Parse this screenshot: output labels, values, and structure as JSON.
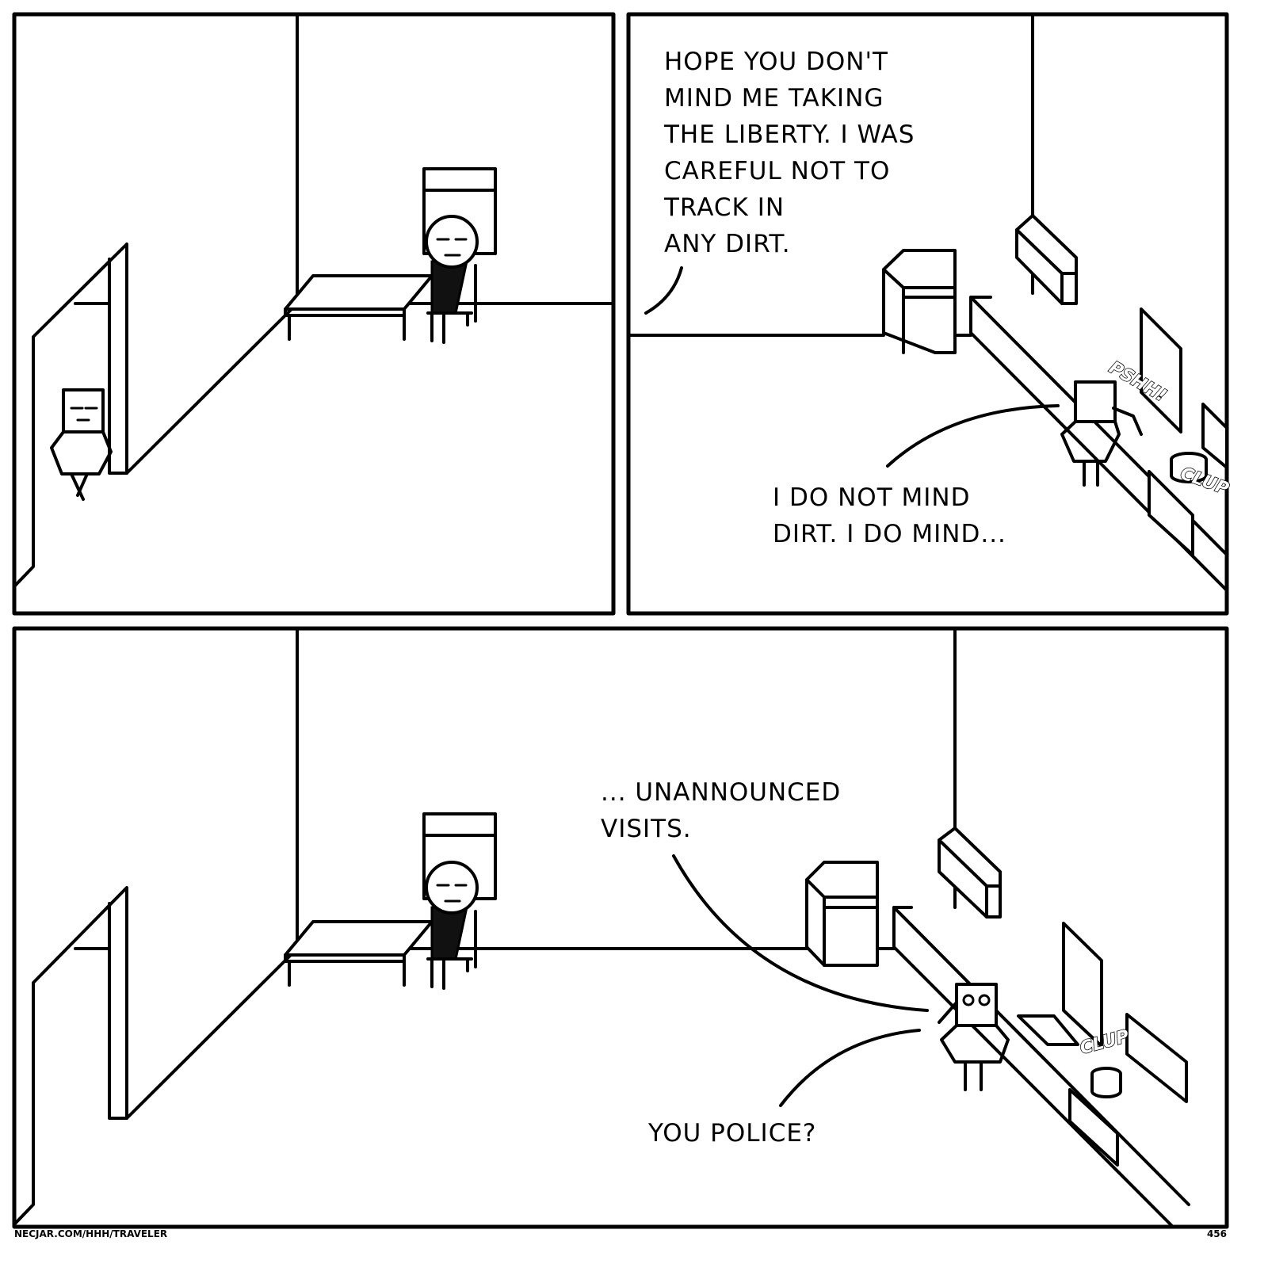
{
  "panel1": {},
  "panel2": {
    "speech_top": [
      "HOPE YOU DON'T",
      "MIND ME TAKING",
      "THE LIBERTY. I WAS",
      "CAREFUL NOT TO",
      "TRACK IN",
      "ANY DIRT."
    ],
    "speech_bottom": [
      "I DO NOT MIND",
      "DIRT. I DO MIND..."
    ],
    "sfx_1": "PSHH!",
    "sfx_2": "CLUP"
  },
  "panel3": {
    "speech_top": [
      "... UNANNOUNCED",
      "VISITS."
    ],
    "speech_bottom": "YOU POLICE?",
    "sfx": "CLUP"
  },
  "footer": {
    "url": "NECJAR.COM/HHH/TRAVELER",
    "page_number": "456"
  }
}
